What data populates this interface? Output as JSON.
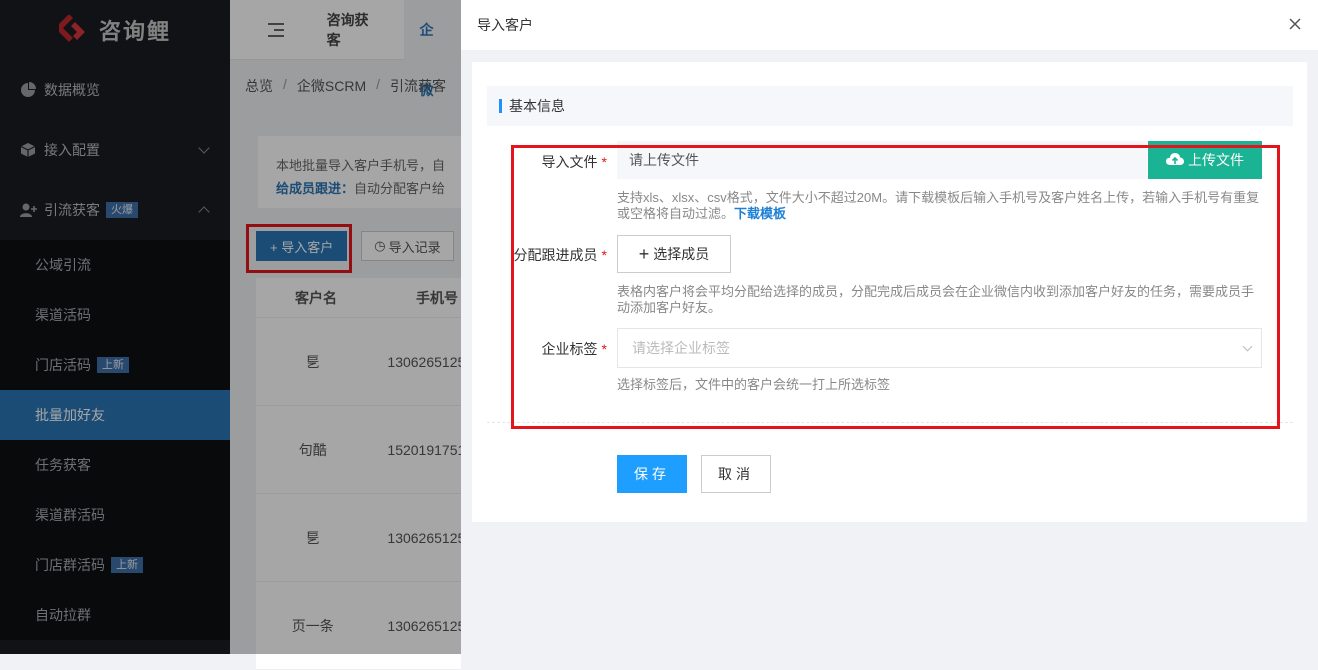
{
  "app": {
    "logo_text": "咨询鲤"
  },
  "sidebar": {
    "items": [
      {
        "label": "数据概览",
        "icon": "pie-chart-icon"
      },
      {
        "label": "接入配置",
        "icon": "cube-icon"
      },
      {
        "label": "引流获客",
        "icon": "user-plus-icon",
        "badge": "火爆"
      }
    ],
    "submenu": [
      {
        "label": "公域引流"
      },
      {
        "label": "渠道活码"
      },
      {
        "label": "门店活码",
        "badge": "上新"
      },
      {
        "label": "批量加好友"
      },
      {
        "label": "任务获客"
      },
      {
        "label": "渠道群活码"
      },
      {
        "label": "门店群活码",
        "badge": "上新"
      },
      {
        "label": "自动拉群"
      }
    ]
  },
  "topbar": {
    "tabs": [
      "咨询获客",
      "企微"
    ]
  },
  "breadcrumb": [
    "总览",
    "企微SCRM",
    "引流获客"
  ],
  "notice": {
    "line1": "本地批量导入客户手机号，自",
    "line2_bold": "给成员跟进：",
    "line2": "自动分配客户给"
  },
  "actions": {
    "import": "+ 导入客户",
    "record": "导入记录"
  },
  "table": {
    "headers": [
      "客户名",
      "手机号"
    ],
    "rows": [
      [
        "乬",
        "1306265125"
      ],
      [
        "句酷",
        "1520191751"
      ],
      [
        "乬",
        "1306265125"
      ],
      [
        "页一条",
        "1306265125"
      ]
    ]
  },
  "dialog": {
    "title": "导入客户",
    "section": "基本信息",
    "file_label": "导入文件",
    "file_placeholder": "请上传文件",
    "upload_button": "上传文件",
    "file_hint": "支持xls、xlsx、csv格式，文件大小不超过20M。请下载模板后输入手机号及客户姓名上传，若输入手机号有重复或空格将自动过滤。",
    "download_link": "下载模板",
    "member_label": "分配跟进成员",
    "member_button": "选择成员",
    "member_hint": "表格内客户将会平均分配给选择的成员，分配完成后成员会在企业微信内收到添加客户好友的任务，需要成员手动添加客户好友。",
    "tag_label": "企业标签",
    "tag_placeholder": "请选择企业标签",
    "tag_hint": "选择标签后，文件中的客户会统一打上所选标签",
    "save": "保存",
    "cancel": "取消",
    "required_mark": "*"
  }
}
